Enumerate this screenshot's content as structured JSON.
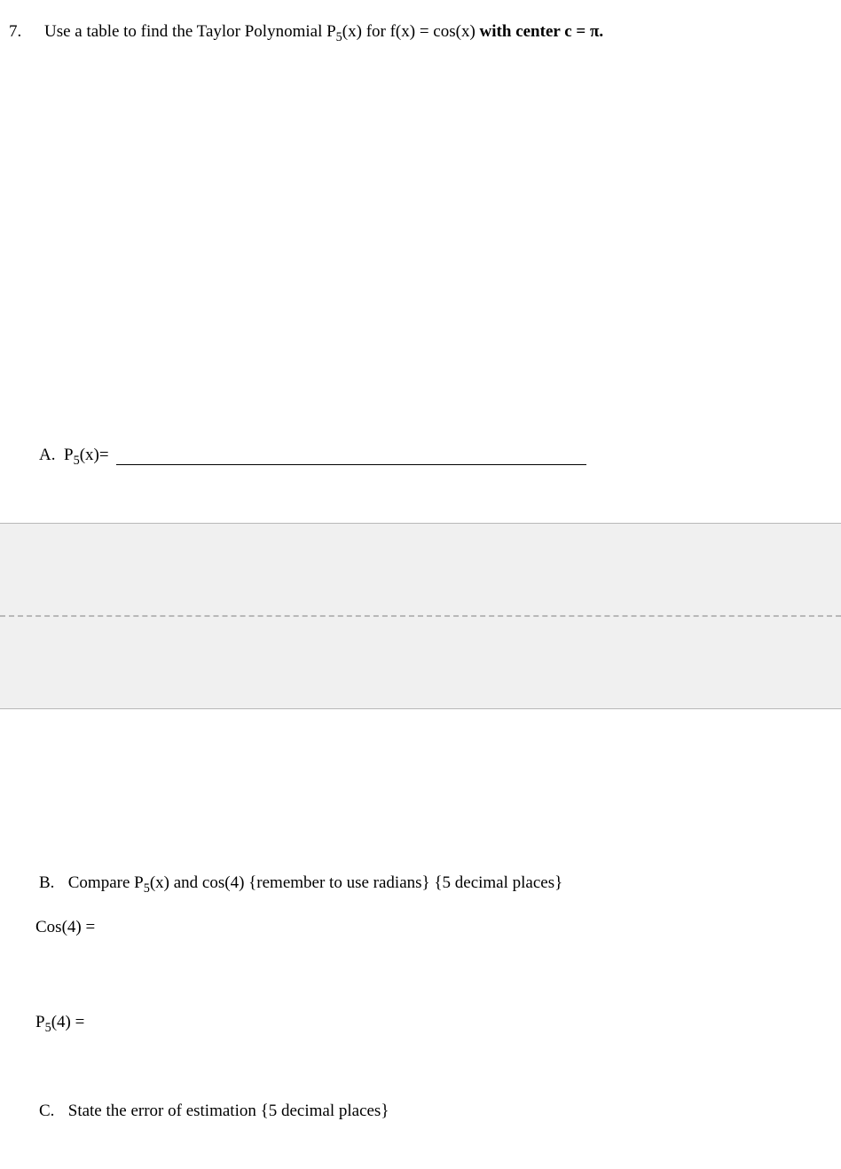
{
  "question_number": "7.",
  "question_prefix": "Use a table to find the Taylor Polynomial P",
  "question_sub1": "5",
  "question_mid1": "(x)  for f(x) = cos(x)  ",
  "question_bold": "with center c = π.",
  "partA": {
    "label": "A.",
    "expr_pre": "P",
    "expr_sub": "5",
    "expr_post": "(x)="
  },
  "partB": {
    "label": "B.",
    "text_pre": "Compare P",
    "text_sub": "5",
    "text_post": "(x)  and cos(4)    {remember to use radians} {5 decimal places}",
    "cos_label": "Cos(4) =",
    "p5_pre": "P",
    "p5_sub": "5",
    "p5_post": "(4)   ="
  },
  "partC": {
    "label": "C.",
    "text": "State the error of estimation {5 decimal places}"
  }
}
